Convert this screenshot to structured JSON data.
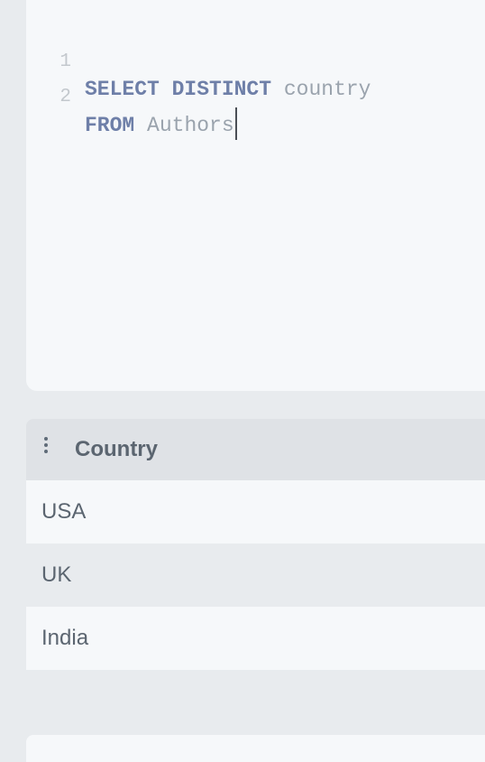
{
  "editor": {
    "lines": [
      {
        "number": "1",
        "keyword": "SELECT DISTINCT",
        "rest": "country"
      },
      {
        "number": "2",
        "keyword": "FROM",
        "rest": "Authors"
      }
    ]
  },
  "results": {
    "column_header": "Country",
    "menu_icon": "vertical-ellipsis-icon",
    "rows": [
      "USA",
      "UK",
      "India"
    ]
  },
  "colors": {
    "keyword": "#6e7fa8",
    "identifier": "#9aa3ad",
    "header_bg": "#dfe2e6"
  }
}
